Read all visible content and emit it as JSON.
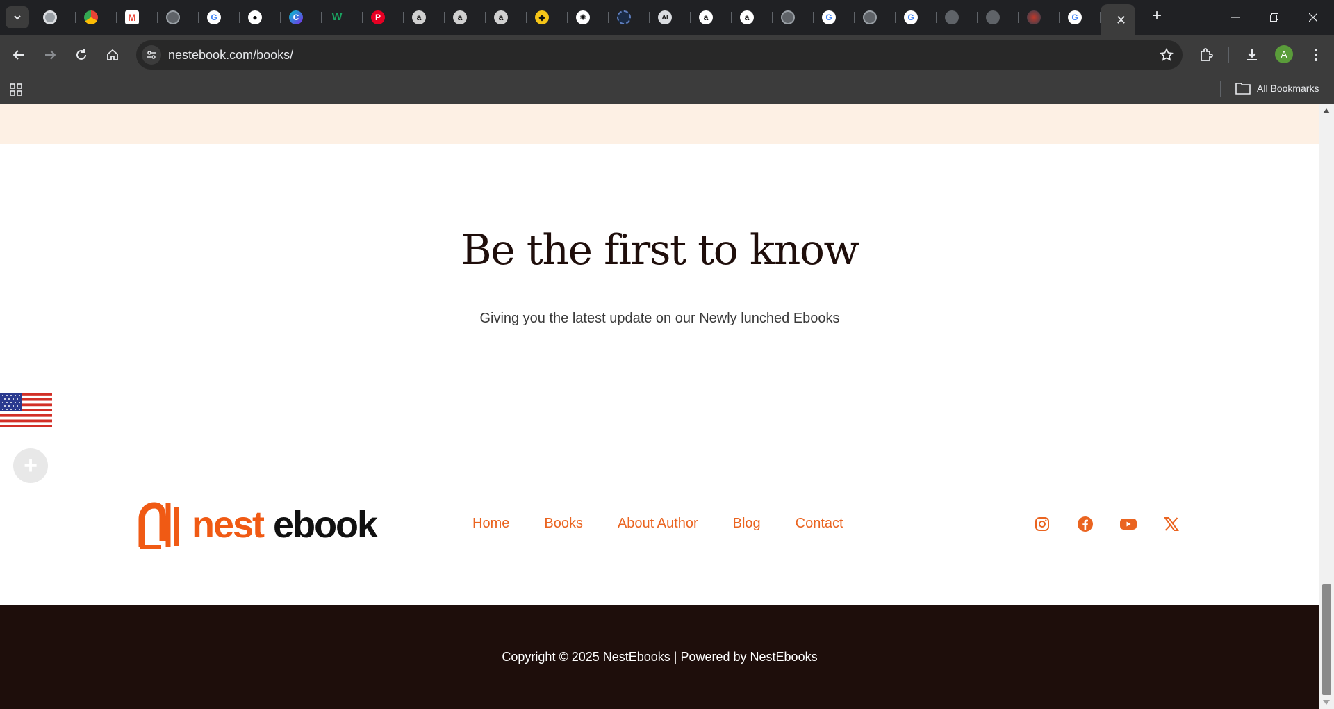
{
  "browser": {
    "tab_count": 27,
    "url": "nestebook.com/books/",
    "profile_initial": "A",
    "all_bookmarks_label": "All Bookmarks",
    "new_tab_glyph": "+",
    "close_tab_glyph": "✕"
  },
  "page": {
    "headline": "Be the first to know",
    "subline": "Giving you the latest update on our Newly lunched Ebooks",
    "logo": {
      "word1": "nest",
      "word2": "ebook"
    },
    "footer_nav": [
      "Home",
      "Books",
      "About Author",
      "Blog",
      "Contact"
    ],
    "social": [
      "instagram-icon",
      "facebook-icon",
      "youtube-icon",
      "x-icon"
    ],
    "copyright": "Copyright © 2025 NestEbooks | Powered by NestEbooks",
    "plus_glyph": "+"
  },
  "colors": {
    "accent": "#ea6420",
    "dark_footer": "#1e0e0b",
    "peach_band": "#fdf0e4",
    "headline": "#1f0e0b"
  }
}
